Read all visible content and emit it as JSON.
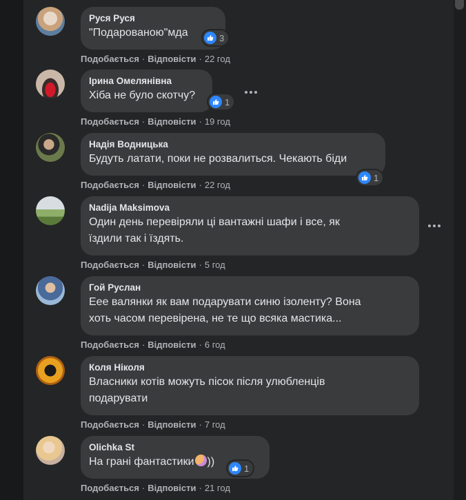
{
  "actions": {
    "like": "Подобається",
    "reply": "Відповісти",
    "sep": "·"
  },
  "colors": {
    "background": "#18191a",
    "panel": "#242526",
    "bubble": "#3a3b3c",
    "like_blue": "#2d88ff",
    "muted": "#b0b3b8"
  },
  "comments": [
    {
      "name": "Руся Руся",
      "text": "\"Подарованою\"мда",
      "time": "22 год",
      "reactions": "3"
    },
    {
      "name": "Ірина Омелянівна",
      "text": "Хіба не було скотчу?",
      "time": "19 год",
      "reactions": "1"
    },
    {
      "name": "Надія Водницька",
      "text": "Будуть латати, поки не розвалиться. Чекають біди",
      "time": "22 год",
      "reactions": "1"
    },
    {
      "name": "Nadija Maksimova",
      "text_lines": [
        "Один день перевіряли ці вантажні шафи і все, як",
        "їздили так і їздять."
      ],
      "time": "5 год"
    },
    {
      "name": "Гой Руслан",
      "text_lines": [
        "Еее валянки як вам подарувати синю ізоленту? Вона",
        "хоть часом перевірена, не те що всяка мастика..."
      ],
      "time": "6 год"
    },
    {
      "name": "Коля Ніколя",
      "text_lines": [
        "Власники котів можуть пісок після улюбленців",
        "подарувати"
      ],
      "time": "7 год"
    },
    {
      "name": "Olichka St",
      "text": "На грані фантастики",
      "text_suffix": "))",
      "time": "21 год",
      "reactions": "1"
    }
  ]
}
